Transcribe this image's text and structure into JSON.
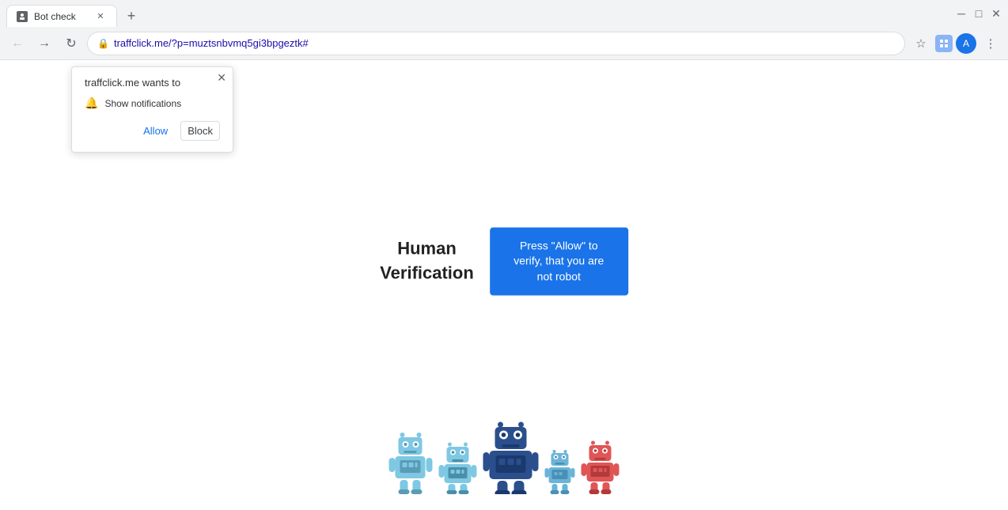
{
  "tab": {
    "title": "Bot check",
    "favicon": "🤖"
  },
  "address_bar": {
    "url": "traffclick.me/?p=muztsnbvmq5gi3bpgeztk#",
    "secure": true
  },
  "notification_popup": {
    "site_name": "traffclick.me",
    "wants_to": "wants to",
    "permission_text": "Show notifications",
    "allow_label": "Allow",
    "block_label": "Block"
  },
  "verification": {
    "title_line1": "Human",
    "title_line2": "Verification",
    "button_text": "Press \"Allow\" to verify, that you are not robot"
  },
  "nav": {
    "back_title": "Back",
    "forward_title": "Forward",
    "reload_title": "Reload"
  }
}
